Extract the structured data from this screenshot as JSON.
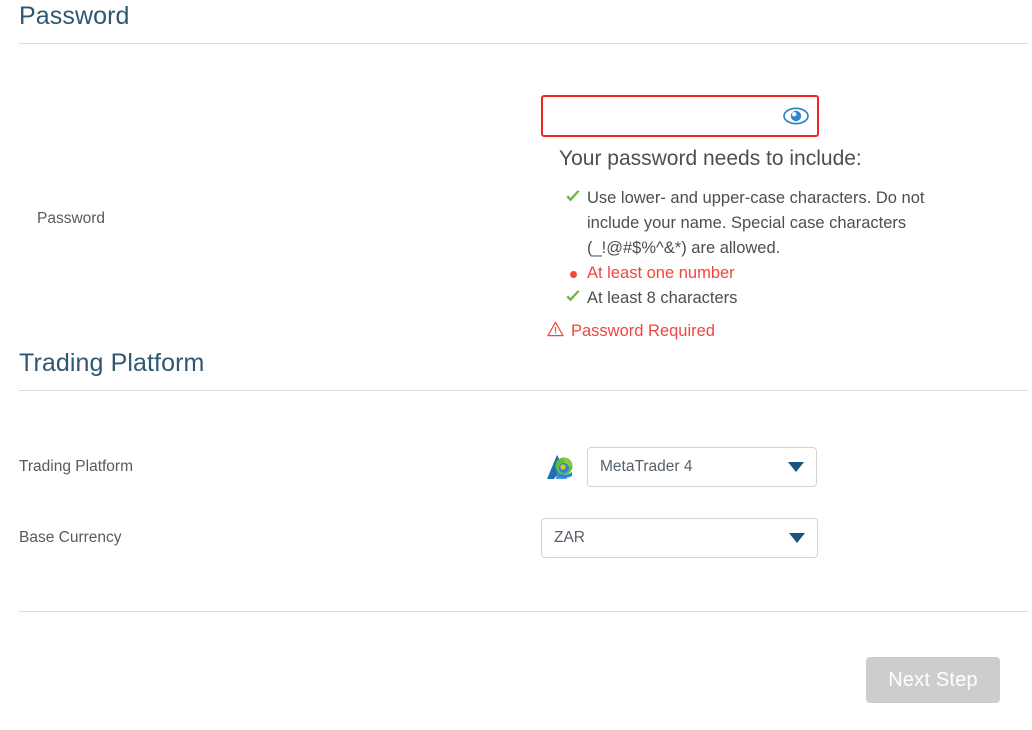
{
  "sections": {
    "password": {
      "heading": "Password",
      "field_label": "Password",
      "input_value": "",
      "input_placeholder": "",
      "toggle_icon": "eye-icon",
      "hint_title": "Your password needs to include:",
      "rules": [
        {
          "text": "Use lower- and upper-case characters. Do not include your name. Special case characters (_!@#$%^&*) are allowed.",
          "status": "met",
          "marker_icon": "green-check-icon"
        },
        {
          "text": "At least one number",
          "status": "unmet",
          "marker_icon": "red-bullet-icon"
        },
        {
          "text": "At least 8 characters",
          "status": "met",
          "marker_icon": "green-check-icon"
        }
      ],
      "error": {
        "icon": "warning-triangle-icon",
        "text": "Password Required"
      }
    },
    "trading_platform": {
      "heading": "Trading Platform",
      "platform": {
        "field_label": "Trading Platform",
        "logo_icon": "metatrader-logo-icon",
        "selected": "MetaTrader 4",
        "caret_icon": "chevron-down-icon"
      },
      "base_currency": {
        "field_label": "Base Currency",
        "selected": "ZAR",
        "caret_icon": "chevron-down-icon"
      }
    }
  },
  "footer": {
    "next_step_label": "Next Step"
  },
  "colors": {
    "heading": "#2e5871",
    "label": "#555b60",
    "error_red": "#f2453d",
    "input_border_error": "#ee2724",
    "success_green": "#6cb33f",
    "caret_blue": "#18557f",
    "eye_blue": "#2e86c8",
    "divider": "#dcdcdc",
    "button_disabled": "#cdcdcd"
  }
}
